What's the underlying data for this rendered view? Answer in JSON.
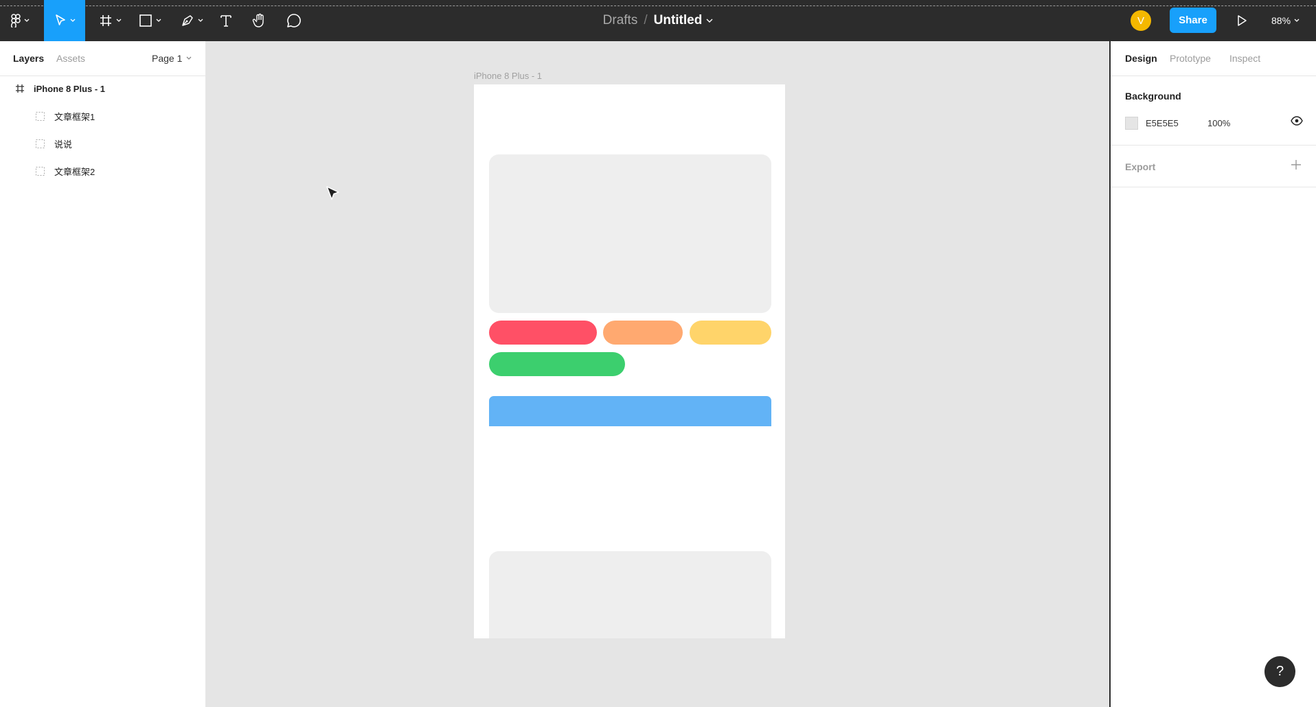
{
  "toolbar": {
    "breadcrumb": {
      "drafts": "Drafts",
      "separator": "/",
      "file_title": "Untitled"
    },
    "avatar_initial": "V",
    "share_label": "Share",
    "zoom_level": "88%",
    "tools": [
      "figma-menu-icon",
      "move-icon",
      "frame-icon",
      "rectangle-icon",
      "pen-icon",
      "text-icon",
      "hand-icon",
      "comment-icon"
    ]
  },
  "left_panel": {
    "tabs": {
      "layers": "Layers",
      "assets": "Assets"
    },
    "page_selector": "Page 1",
    "layers": [
      {
        "name": "iPhone 8 Plus - 1",
        "icon": "frame-hash-icon"
      },
      {
        "name": "文章框架1",
        "icon": "frame-dashed-icon"
      },
      {
        "name": "说说",
        "icon": "frame-dashed-icon"
      },
      {
        "name": "文章框架2",
        "icon": "frame-dashed-icon"
      }
    ]
  },
  "right_panel": {
    "tabs": {
      "design": "Design",
      "prototype": "Prototype",
      "inspect": "Inspect"
    },
    "background": {
      "title": "Background",
      "hex": "E5E5E5",
      "opacity": "100%",
      "swatch_color": "#E5E5E5"
    },
    "export": {
      "title": "Export"
    }
  },
  "canvas": {
    "frame_label": "iPhone 8 Plus - 1",
    "colors": {
      "card": "#EEEEEE",
      "red_pill": "#FF5066",
      "orange_pill": "#FFA970",
      "yellow_pill": "#FFD46A",
      "green_pill": "#3CCF6E",
      "blue_bar": "#62B3F6"
    }
  },
  "help_label": "?"
}
